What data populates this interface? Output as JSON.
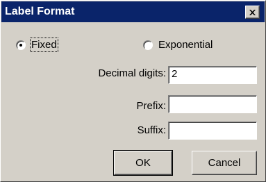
{
  "window": {
    "title": "Label Format",
    "title_bar_color": "#0a246a",
    "face_color": "#d4d0c8"
  },
  "close_button": {
    "label": "×",
    "icon": "close-icon"
  },
  "format_options": {
    "fixed": {
      "label": "Fixed",
      "checked": true
    },
    "exponential": {
      "label": "Exponential",
      "checked": false
    }
  },
  "fields": {
    "decimal_digits": {
      "label": "Decimal digits:",
      "value": "2"
    },
    "prefix": {
      "label": "Prefix:",
      "value": ""
    },
    "suffix": {
      "label": "Suffix:",
      "value": ""
    }
  },
  "buttons": {
    "ok": "OK",
    "cancel": "Cancel"
  }
}
